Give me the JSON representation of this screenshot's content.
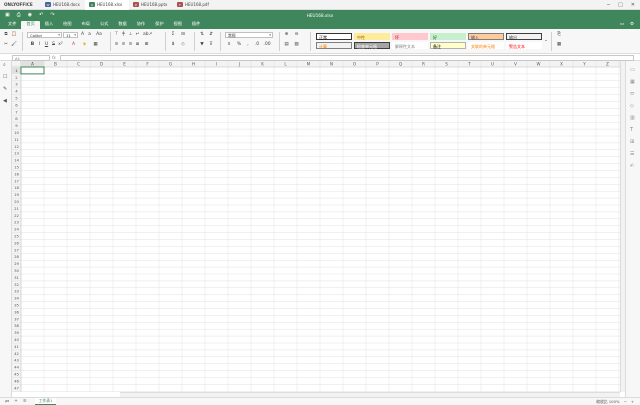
{
  "app": {
    "brand": "ONLYOFFICE",
    "doc_tabs": [
      {
        "label": "HEU168.docx",
        "type": "docx",
        "color": "#446995"
      },
      {
        "label": "HEU168.xlsx",
        "type": "xlsx",
        "color": "#40865c"
      },
      {
        "label": "HEU168.pptx",
        "type": "pptx",
        "color": "#aa5252"
      },
      {
        "label": "HEU168.pdf",
        "type": "pdf",
        "color": "#aa5252"
      }
    ],
    "title": "HEU168.xlsx"
  },
  "menu": {
    "items": [
      "文件",
      "首页",
      "插入",
      "绘图",
      "布局",
      "公式",
      "数据",
      "协作",
      "保护",
      "视图",
      "插件"
    ],
    "active_index": 1
  },
  "toolbar": {
    "font_name": "Calibri",
    "font_size": "11",
    "number_format": "常规",
    "cell_styles": [
      {
        "label": "正常",
        "bg": "#ffffff",
        "fg": "#000000",
        "border": "#333333"
      },
      {
        "label": "中性",
        "bg": "#ffeb9c",
        "fg": "#9c6500",
        "border": ""
      },
      {
        "label": "坏",
        "bg": "#ffc7ce",
        "fg": "#9c0006",
        "border": ""
      },
      {
        "label": "好",
        "bg": "#c6efce",
        "fg": "#006100",
        "border": ""
      },
      {
        "label": "输入",
        "bg": "#ffcc99",
        "fg": "#3f3f76",
        "border": "#7f7f7f"
      },
      {
        "label": "输出",
        "bg": "#f2f2f2",
        "fg": "#3f3f3f",
        "border": "#3f3f3f"
      },
      {
        "label": "计算",
        "bg": "#f2f2f2",
        "fg": "#fa7d00",
        "border": "#7f7f7f"
      },
      {
        "label": "检查单元格",
        "bg": "#a5a5a5",
        "fg": "#ffffff",
        "border": "#3f3f3f"
      },
      {
        "label": "解释性文本",
        "bg": "#ffffff",
        "fg": "#7f7f7f",
        "border": ""
      },
      {
        "label": "备注",
        "bg": "#ffffcc",
        "fg": "#000000",
        "border": "#b2b2b2"
      },
      {
        "label": "关联的单元格",
        "bg": "#ffffff",
        "fg": "#fa7d00",
        "border": ""
      },
      {
        "label": "警告文本",
        "bg": "#ffffff",
        "fg": "#ff0000",
        "border": ""
      }
    ]
  },
  "formula_bar": {
    "name_box": "A1",
    "fx": "fx",
    "value": ""
  },
  "grid": {
    "columns": [
      "A",
      "B",
      "C",
      "D",
      "E",
      "F",
      "G",
      "H",
      "I",
      "J",
      "K",
      "L",
      "M",
      "N",
      "O",
      "P",
      "Q",
      "R",
      "S",
      "T",
      "U",
      "V",
      "W",
      "X",
      "Y",
      "Z"
    ],
    "row_count": 48,
    "selected_cell": "A1"
  },
  "statusbar": {
    "sheet_tab": "工作表1",
    "zoom_label": "缩放比 100%"
  },
  "colors": {
    "accent": "#40865c",
    "grid_line": "#e1e1e1",
    "header_bg": "#f3f3f3",
    "selection": "#40865c"
  }
}
